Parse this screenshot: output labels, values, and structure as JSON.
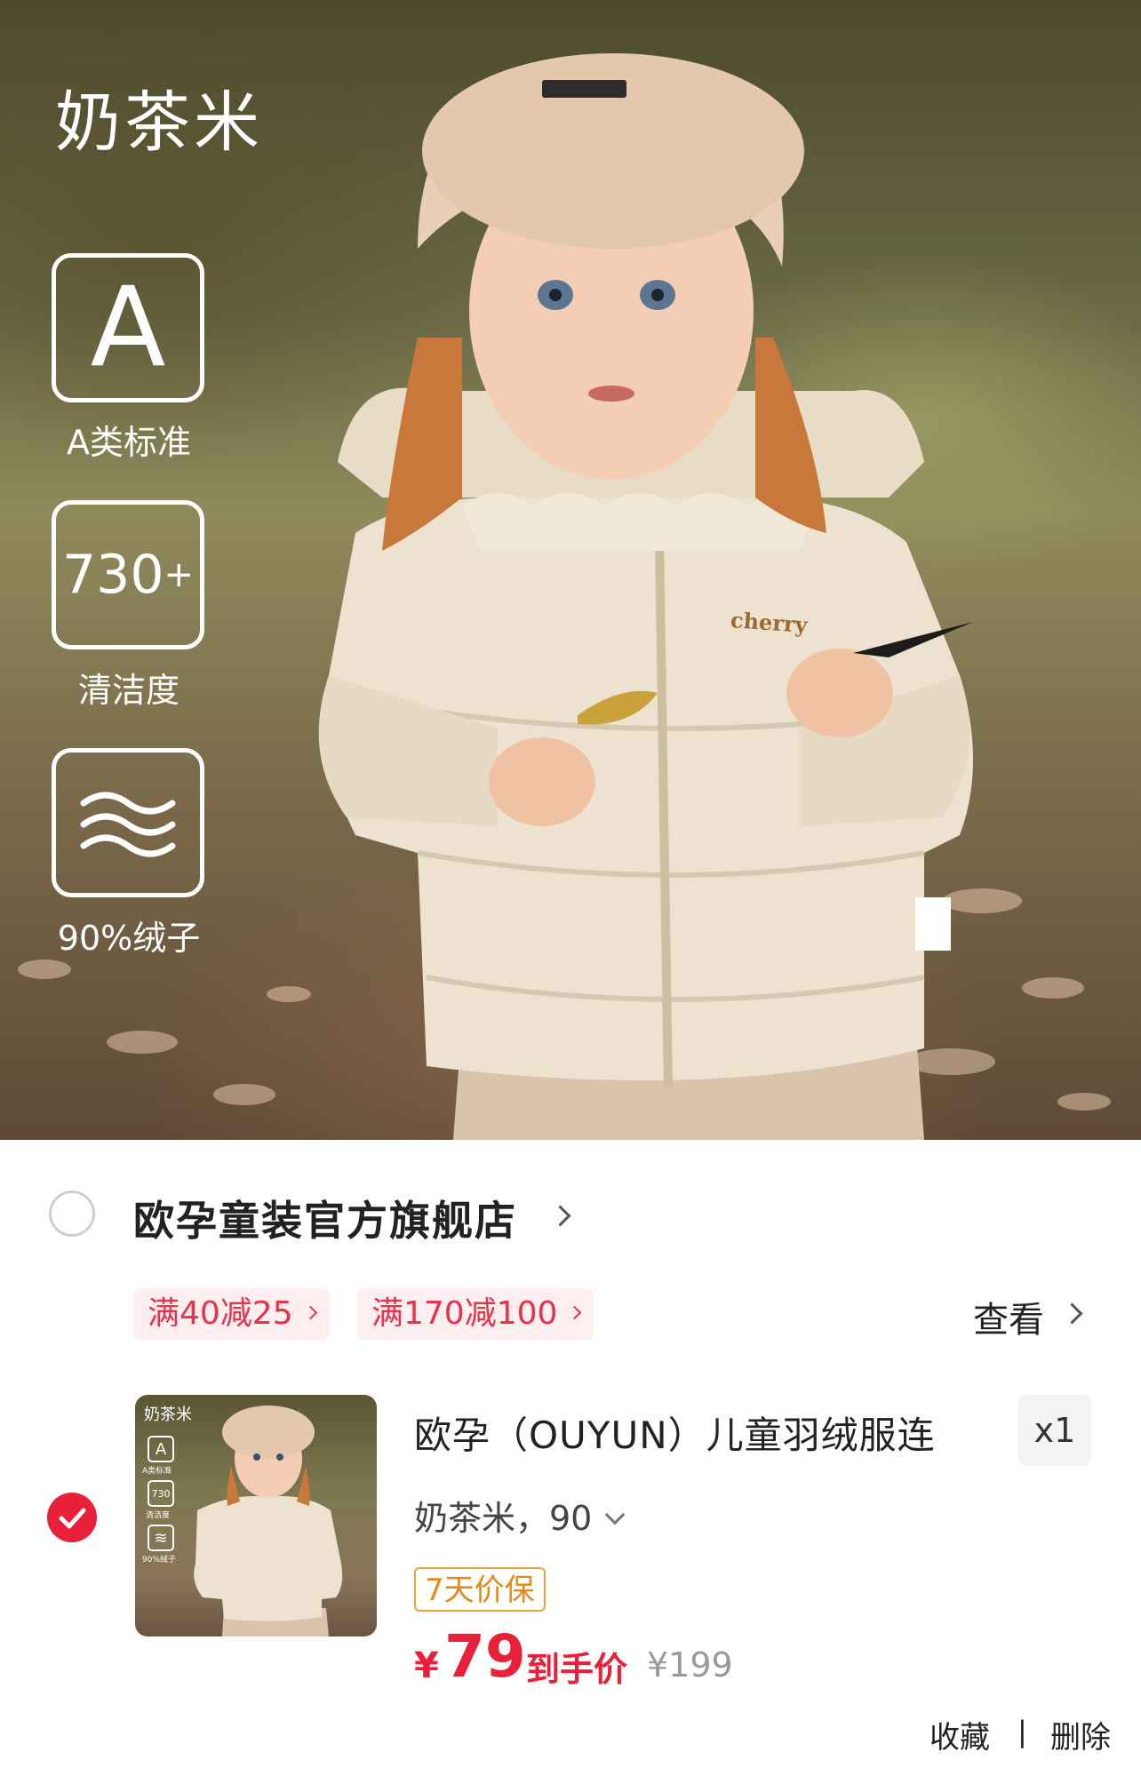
{
  "hero": {
    "title": "奶茶米",
    "badges": [
      {
        "symbol": "A",
        "label": "A类标准",
        "icon": "grade-a-icon"
      },
      {
        "symbol": "730",
        "sup": "+",
        "label": "清洁度",
        "icon": "cleanliness-icon"
      },
      {
        "symbol": "",
        "label": "90%绒子",
        "icon": "down-wave-icon"
      }
    ],
    "jacket_text": "cherry"
  },
  "cart": {
    "store_name": "欧孕童装官方旗舰店",
    "promotions": [
      "满40减25",
      "满170减100"
    ],
    "view_label": "查看",
    "item": {
      "title": "欧孕（OUYUN）儿童羽绒服连",
      "quantity": "x1",
      "variant": "奶茶米，90",
      "guarantee": "7天价保",
      "price_currency": "¥",
      "price": "79",
      "price_tag": "到手价",
      "original_price": "¥199",
      "thumb": {
        "title": "奶茶米",
        "a_label": "A类标准",
        "cleanliness": "730",
        "cleanliness_label": "清洁度",
        "down_label": "90%绒子"
      }
    },
    "actions": {
      "favorite": "收藏",
      "separator": "|",
      "delete": "删除"
    }
  },
  "colors": {
    "accent": "#e8203a",
    "promo_bg": "#fdeef0",
    "guarantee": "#e48a1a"
  }
}
